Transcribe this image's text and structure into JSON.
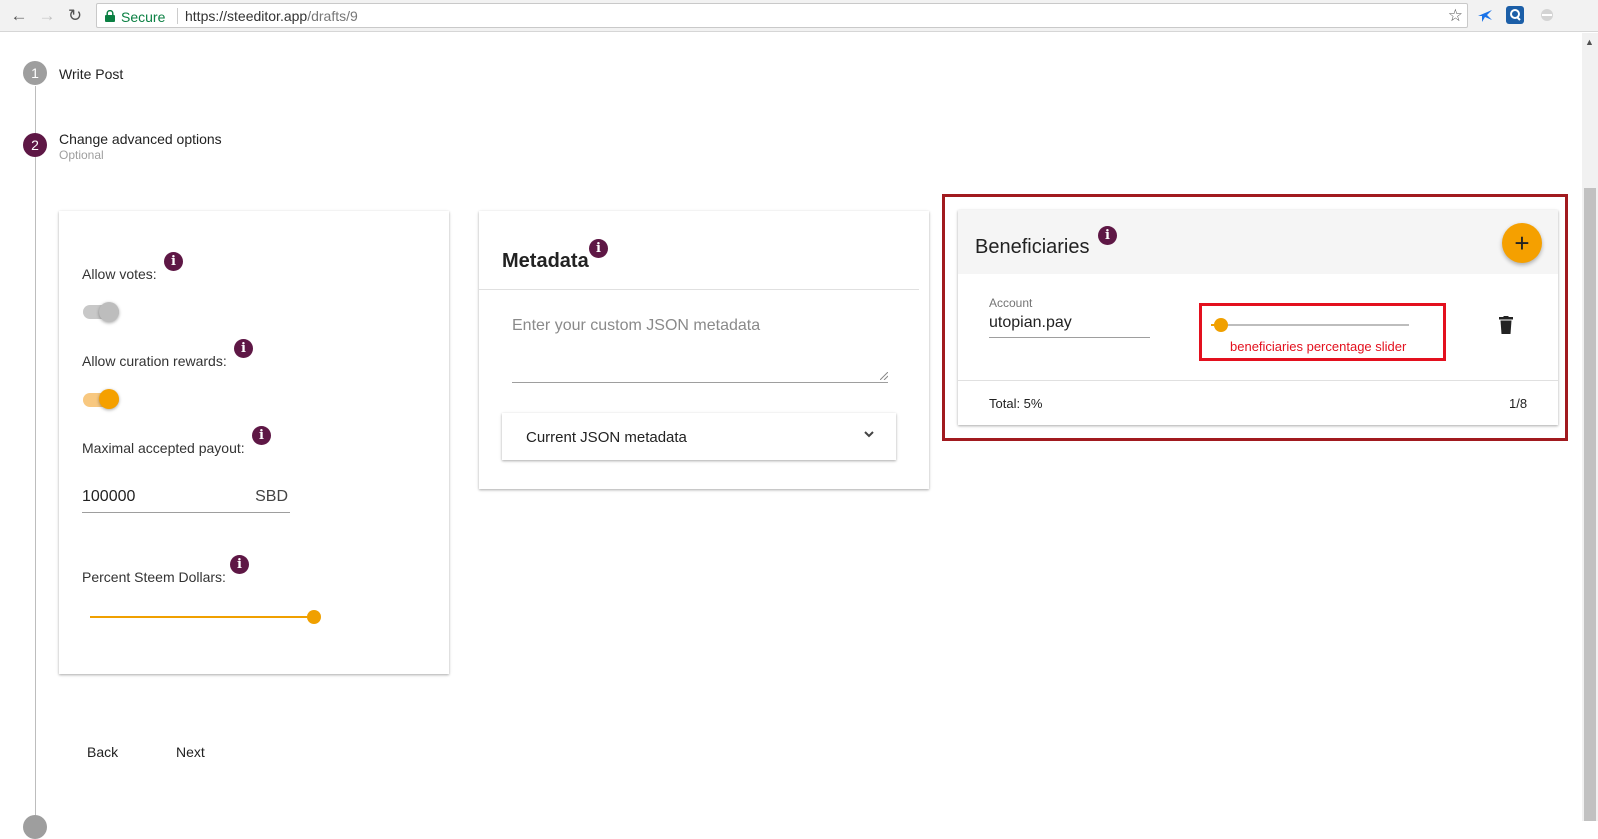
{
  "browser": {
    "secure_label": "Secure",
    "url_host": "https://steeditor.app",
    "url_path": "/drafts/9"
  },
  "stepper": {
    "steps": [
      {
        "number": "1",
        "title": "Write Post",
        "subtitle": ""
      },
      {
        "number": "2",
        "title": "Change advanced options",
        "subtitle": "Optional"
      }
    ]
  },
  "options": {
    "allow_votes_label": "Allow votes:",
    "allow_votes_on": false,
    "allow_curation_label": "Allow curation rewards:",
    "allow_curation_on": true,
    "max_payout_label": "Maximal accepted payout:",
    "max_payout_value": "100000",
    "max_payout_unit": "SBD",
    "percent_sd_label": "Percent Steem Dollars:",
    "percent_sd_fraction": 1.0
  },
  "actions": {
    "back_label": "Back",
    "next_label": "Next"
  },
  "metadata": {
    "title": "Metadata",
    "placeholder": "Enter your custom JSON metadata",
    "current_label": "Current JSON metadata"
  },
  "beneficiaries": {
    "title": "Beneficiaries",
    "account_label": "Account",
    "account_value": "utopian.pay",
    "slider_fraction": 0.05,
    "annotation": "beneficiaries percentage slider",
    "total_label": "Total: 5%",
    "count_label": "1/8"
  },
  "colors": {
    "accent": "#f5a000",
    "info": "#5e1745",
    "highlight_border": "#a11a1f",
    "annotation": "#e3101e"
  }
}
